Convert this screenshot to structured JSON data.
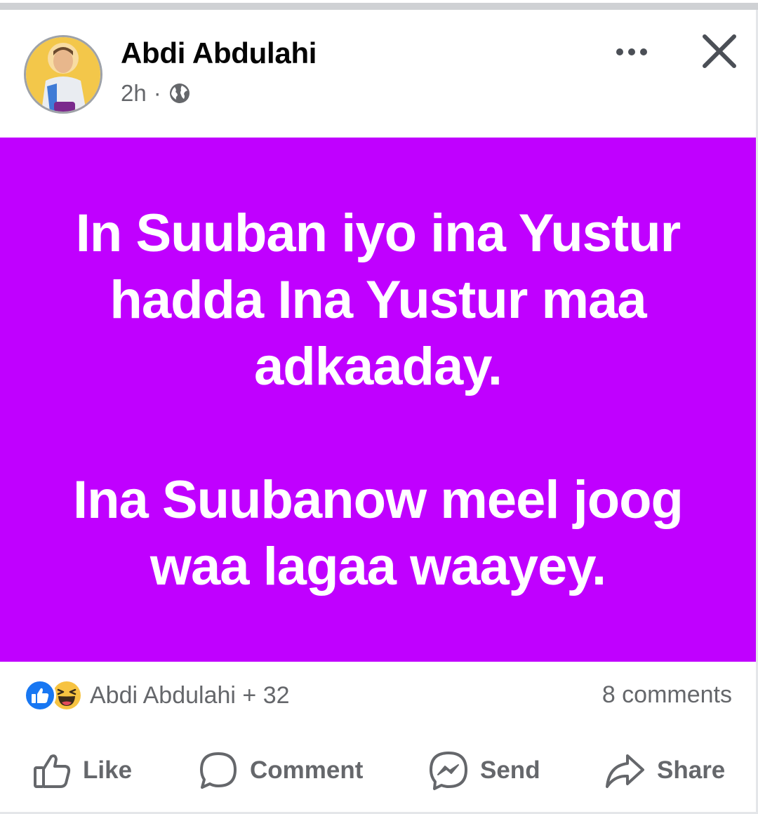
{
  "post": {
    "author": "Abdi Abdulahi",
    "time": "2h",
    "separator": "·",
    "audience_icon": "globe-icon",
    "background_color": "#c000ff",
    "text_color": "#ffffff",
    "paragraphs": [
      [
        "In Suuban iyo ina Yustur",
        "hadda Ina Yustur maa",
        "adkaaday."
      ],
      [
        "Ina Suubanow meel joog",
        "waa lagaa waayey."
      ]
    ]
  },
  "reactions": {
    "icons": [
      "like-react-icon",
      "haha-react-icon"
    ],
    "summary": "Abdi Abdulahi + 32",
    "comments": "8 comments"
  },
  "actions": {
    "like": "Like",
    "comment": "Comment",
    "send": "Send",
    "share": "Share"
  },
  "colors": {
    "secondary_text": "#65676b",
    "like_blue": "#1877f2",
    "haha_yellow": "#f7c341"
  }
}
